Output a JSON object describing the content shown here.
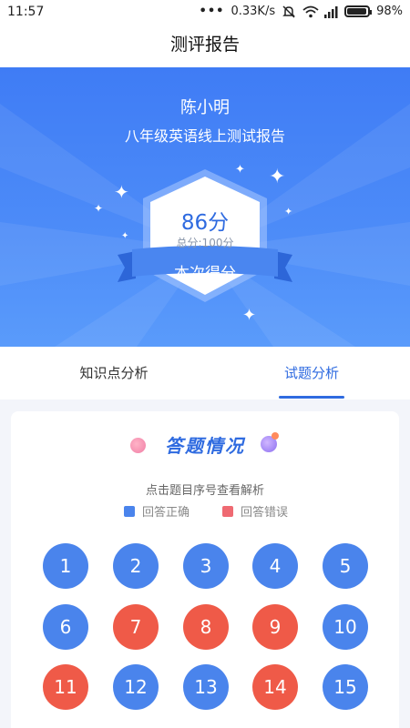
{
  "status_bar": {
    "time": "11:57",
    "net_speed": "0.33K/s",
    "battery": "98%"
  },
  "header": {
    "title": "测评报告"
  },
  "report": {
    "student_name": "陈小明",
    "title": "八年级英语线上测试报告",
    "score": "86分",
    "total": "总分:100分",
    "ribbon": "本次得分"
  },
  "tabs": [
    {
      "label": "知识点分析",
      "active": false
    },
    {
      "label": "试题分析",
      "active": true
    }
  ],
  "answers": {
    "section_title": "答题情况",
    "hint": "点击题目序号查看解析",
    "legend": {
      "correct": "回答正确",
      "wrong": "回答错误"
    },
    "colors": {
      "correct": "#4a84ec",
      "wrong": "#ef5a48"
    },
    "questions": [
      {
        "no": "1",
        "correct": true
      },
      {
        "no": "2",
        "correct": true
      },
      {
        "no": "3",
        "correct": true
      },
      {
        "no": "4",
        "correct": true
      },
      {
        "no": "5",
        "correct": true
      },
      {
        "no": "6",
        "correct": true
      },
      {
        "no": "7",
        "correct": false
      },
      {
        "no": "8",
        "correct": false
      },
      {
        "no": "9",
        "correct": false
      },
      {
        "no": "10",
        "correct": true
      },
      {
        "no": "11",
        "correct": false
      },
      {
        "no": "12",
        "correct": true
      },
      {
        "no": "13",
        "correct": true
      },
      {
        "no": "14",
        "correct": false
      },
      {
        "no": "15",
        "correct": true
      }
    ]
  }
}
